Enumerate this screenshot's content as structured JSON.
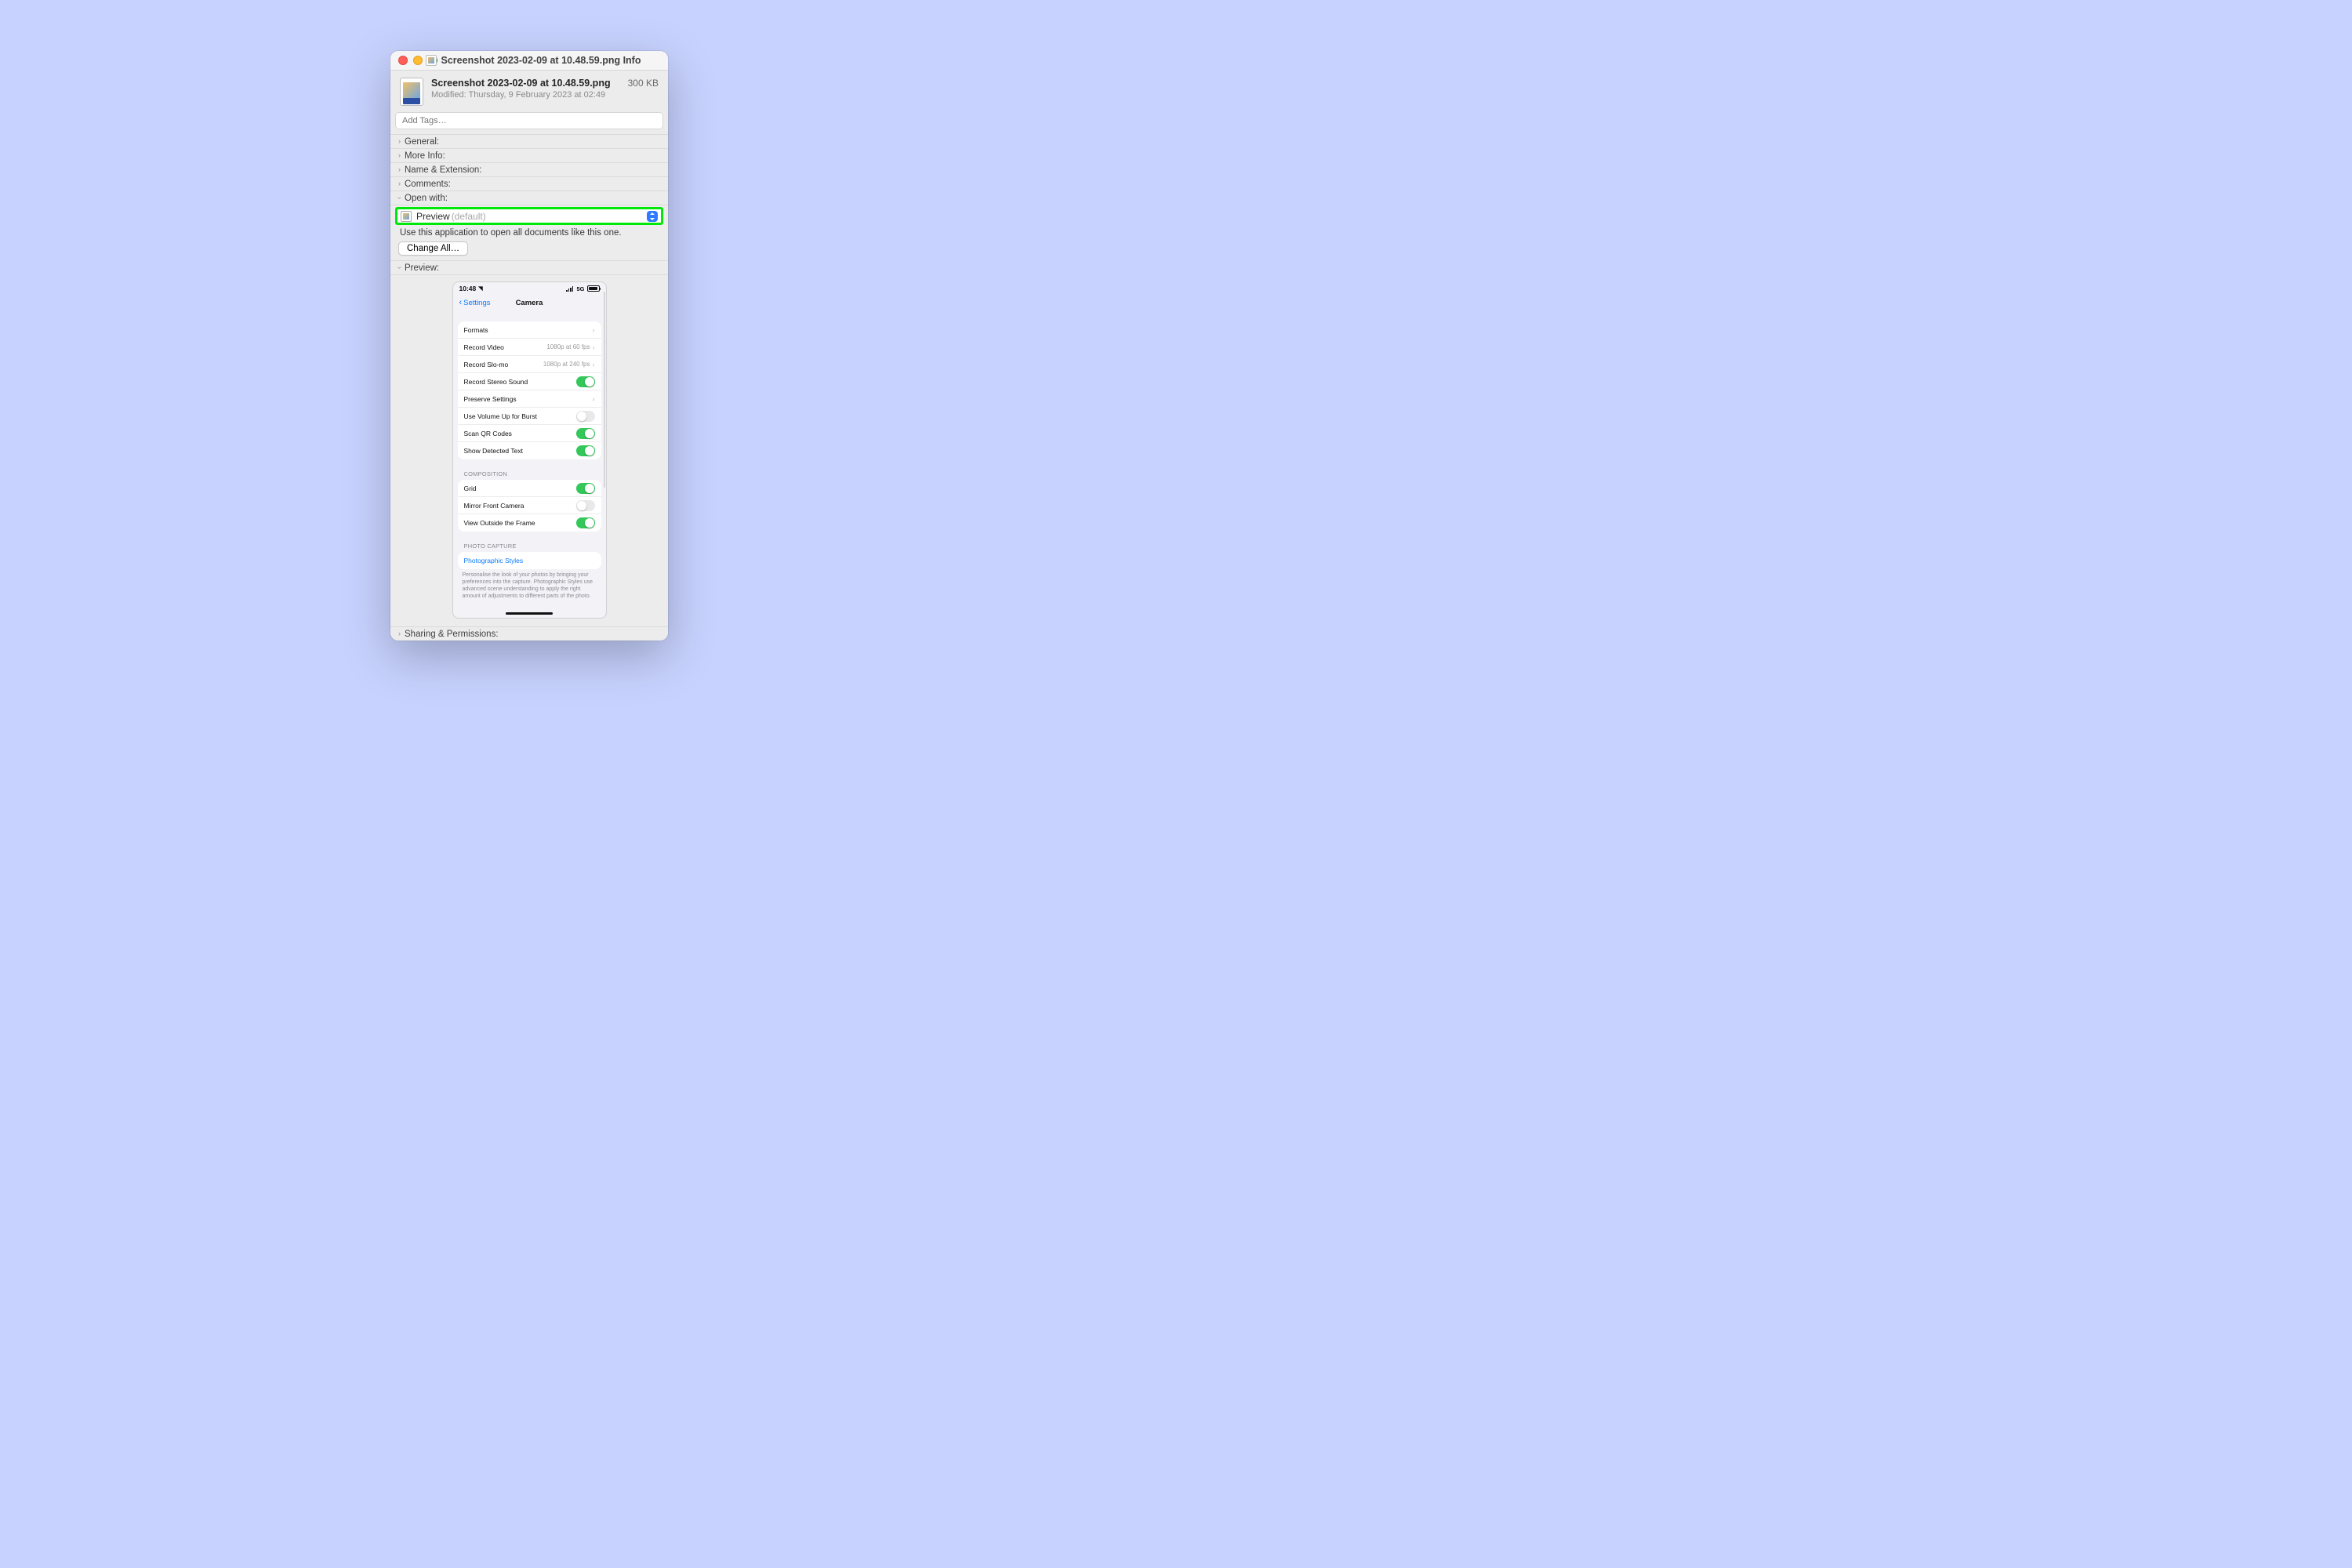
{
  "window": {
    "title": "Screenshot 2023-02-09 at 10.48.59.png Info"
  },
  "file": {
    "name": "Screenshot 2023-02-09 at 10.48.59.png",
    "modified_label": "Modified:",
    "modified_value": "Thursday, 9 February 2023 at 02:49",
    "size": "300 KB"
  },
  "tags": {
    "placeholder": "Add Tags…"
  },
  "sections": {
    "general": "General:",
    "more_info": "More Info:",
    "name_ext": "Name & Extension:",
    "comments": "Comments:",
    "open_with": "Open with:",
    "preview": "Preview:",
    "sharing": "Sharing & Permissions:"
  },
  "open_with": {
    "app": "Preview",
    "default_suffix": "(default)",
    "hint": "Use this application to open all documents like this one.",
    "change_all": "Change All…"
  },
  "phone": {
    "time": "10:48",
    "network": "5G",
    "nav_back": "Settings",
    "nav_title": "Camera",
    "rows1": {
      "formats": "Formats",
      "record_video": {
        "label": "Record Video",
        "value": "1080p at 60 fps"
      },
      "record_slomo": {
        "label": "Record Slo-mo",
        "value": "1080p at 240 fps"
      },
      "stereo": "Record Stereo Sound",
      "preserve": "Preserve Settings",
      "volume_burst": "Use Volume Up for Burst",
      "scan_qr": "Scan QR Codes",
      "detected_text": "Show Detected Text"
    },
    "composition_header": "COMPOSITION",
    "rows2": {
      "grid": "Grid",
      "mirror": "Mirror Front Camera",
      "outside": "View Outside the Frame"
    },
    "photo_capture_header": "PHOTO CAPTURE",
    "photographic_styles": "Photographic Styles",
    "caption": "Personalise the look of your photos by bringing your preferences into the capture. Photographic Styles use advanced scene understanding to apply the right amount of adjustments to different parts of the photo."
  }
}
